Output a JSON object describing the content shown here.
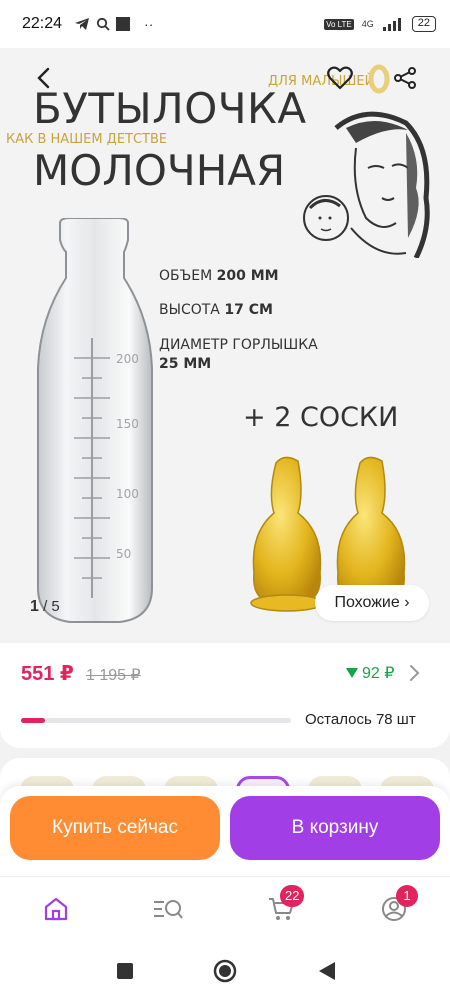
{
  "status_bar": {
    "time": "22:24",
    "network": "4G",
    "volte": "Vo LTE",
    "battery": "22"
  },
  "product_image": {
    "title_line1": "БУТЫЛОЧКА",
    "title_line2": "МОЛОЧНАЯ",
    "subtitle": "КАК В НАШЕМ ДЕТСТВЕ",
    "brand": "ДЛЯ МАЛЫШЕЙ",
    "specs": [
      {
        "label": "ОБЪЕМ ",
        "value": "200 ММ"
      },
      {
        "label": "ВЫСОТА ",
        "value": "17 СМ"
      },
      {
        "label": "ДИАМЕТР ГОРЛЫШКА",
        "value": "25 ММ"
      }
    ],
    "bonus": "+ 2 СОСКИ",
    "bottle_marks": [
      "200",
      "150",
      "100",
      "50"
    ],
    "current_image": "1",
    "total_images": "5",
    "similar_label": "Похожие ›"
  },
  "price": {
    "current": "551 ₽",
    "old": "1 195 ₽",
    "cashback": "92 ₽",
    "stock_fraction": 0.09,
    "stock_text": "Осталось 78 шт"
  },
  "actions": {
    "buy_now": "Купить сейчас",
    "add_to_cart": "В корзину"
  },
  "tabs": {
    "cart_badge": "22",
    "profile_badge": "1"
  },
  "colors": {
    "accent": "#a13ee6",
    "buy": "#ff8c32",
    "price": "#e0245e",
    "cashback": "#1aa24a",
    "gold": "#c9a43a"
  }
}
